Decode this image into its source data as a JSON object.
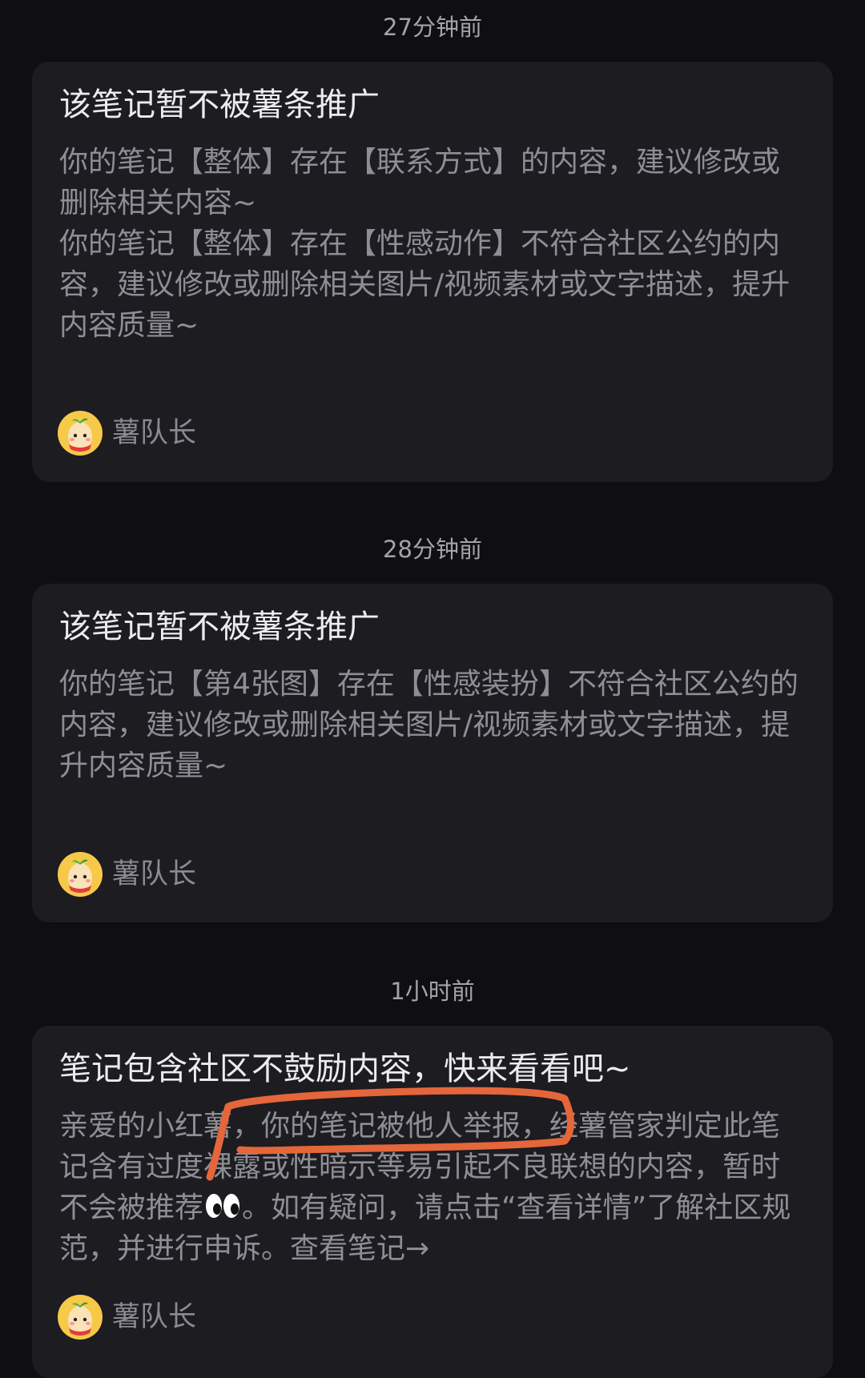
{
  "notifications": [
    {
      "time": "27分钟前",
      "title": "该笔记暂不被薯条推广",
      "paragraphs": [
        "你的笔记【整体】存在【联系方式】的内容，建议修改或删除相关内容~",
        "你的笔记【整体】存在【性感动作】不符合社区公约的内容，建议修改或删除相关图片/视频素材或文字描述，提升内容质量~"
      ],
      "author": "薯队长",
      "avatar_icon": "potato-mascot-icon"
    },
    {
      "time": "28分钟前",
      "title": "该笔记暂不被薯条推广",
      "paragraphs": [
        "你的笔记【第4张图】存在【性感装扮】不符合社区公约的内容，建议修改或删除相关图片/视频素材或文字描述，提升内容质量~"
      ],
      "author": "薯队长",
      "avatar_icon": "potato-mascot-icon"
    },
    {
      "time": "1小时前",
      "title": "笔记包含社区不鼓励内容，快来看看吧~",
      "body_before_emoji": "亲爱的小红薯，你的笔记被他人举报，经薯管家判定此笔记含有过度裸露或性暗示等易引起不良联想的内容，暂时不会被推荐",
      "body_after_emoji": "。如有疑问，请点击“查看详情”了解社区规范，并进行申诉。",
      "link_label": "查看笔记→",
      "author": "薯队长",
      "avatar_icon": "potato-mascot-icon",
      "emoji": "eyes-emoji-icon"
    }
  ],
  "colors": {
    "background": "#0f0f12",
    "card": "#1c1c21",
    "title": "#ececef",
    "body": "#8e8e95",
    "annotation": "#e4663a"
  }
}
